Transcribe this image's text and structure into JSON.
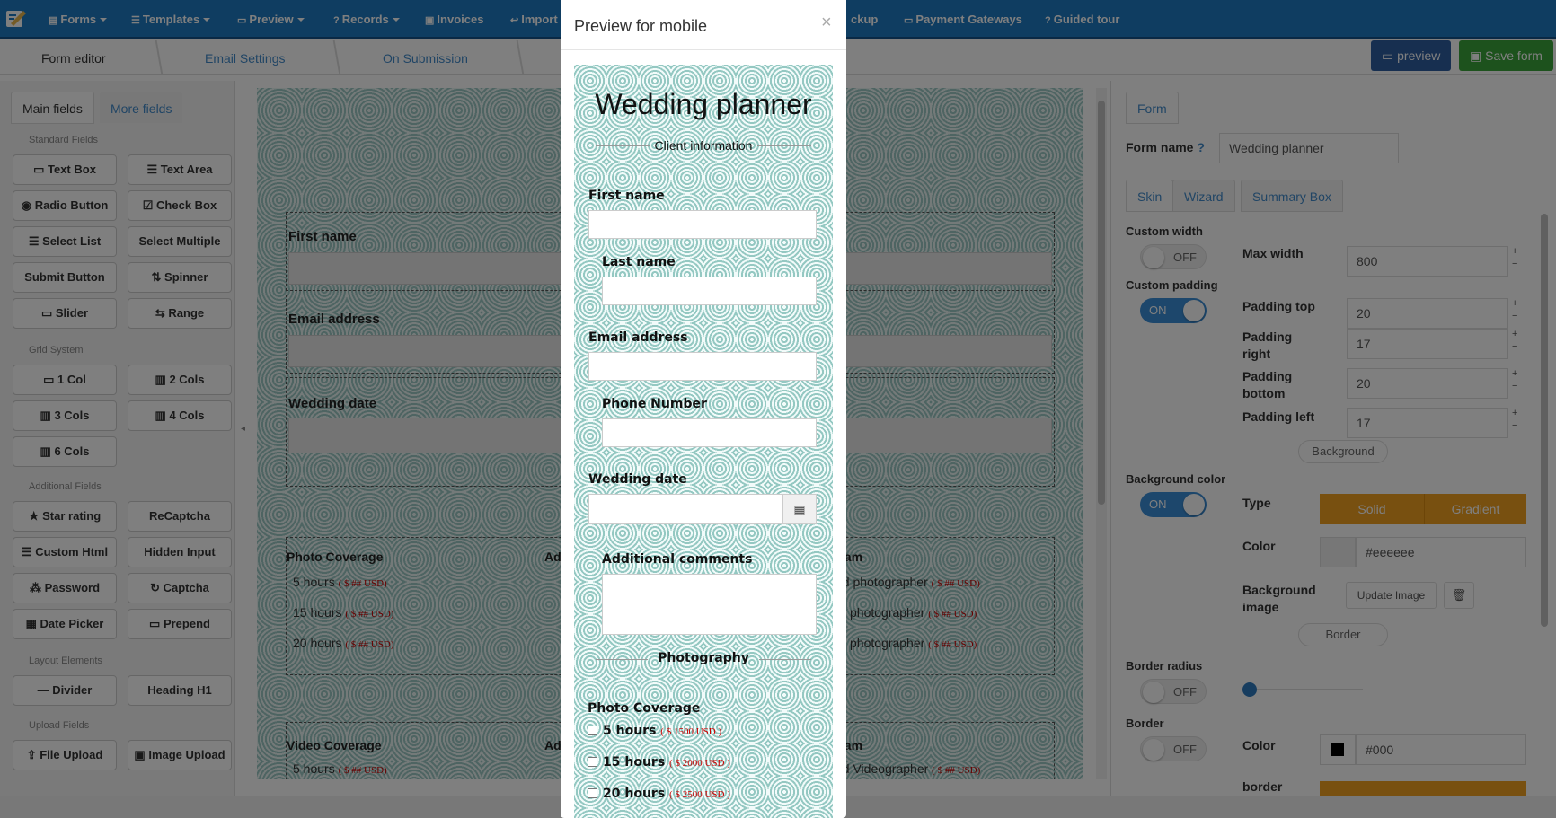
{
  "nav": {
    "items": [
      {
        "label": "Forms",
        "icon": "file-icon"
      },
      {
        "label": "Templates",
        "icon": "list-icon"
      },
      {
        "label": "Preview",
        "icon": "monitor-icon"
      },
      {
        "label": "Records",
        "icon": "question-icon"
      },
      {
        "label": "Invoices",
        "icon": "invoice-icon"
      },
      {
        "label": "Import",
        "icon": "reply-icon"
      },
      {
        "label": "ckup",
        "icon": ""
      },
      {
        "label": "Payment Gateways",
        "icon": "credit-card-icon"
      },
      {
        "label": "Guided tour",
        "icon": "question-icon"
      }
    ]
  },
  "editor_tabs": {
    "form_editor": "Form editor",
    "email_settings": "Email Settings",
    "on_submission": "On Submission"
  },
  "header_buttons": {
    "preview": "preview",
    "save": "Save form"
  },
  "left_panel": {
    "tabs": {
      "main": "Main fields",
      "more": "More fields"
    },
    "groups": {
      "standard": "Standard Fields",
      "grid": "Grid System",
      "additional": "Additional Fields",
      "layout": "Layout Elements",
      "upload": "Upload Fields"
    },
    "standard_fields": [
      "Text Box",
      "Text Area",
      "Radio Button",
      "Check Box",
      "Select List",
      "Select Multiple",
      "Submit Button",
      "Spinner",
      "Slider",
      "Range"
    ],
    "grid_fields": [
      "1 Col",
      "2 Cols",
      "3 Cols",
      "4 Cols",
      "6 Cols"
    ],
    "additional_fields": [
      "Star rating",
      "ReCaptcha",
      "Custom Html",
      "Hidden Input",
      "Password",
      "Captcha",
      "Date Picker",
      "Prepend"
    ],
    "layout_fields": [
      "Divider",
      "Heading H1"
    ],
    "upload_fields": [
      "File Upload",
      "Image Upload"
    ]
  },
  "canvas": {
    "labels": {
      "first_name": "First name",
      "email": "Email address",
      "wedding_date": "Wedding date",
      "photo_coverage": "Photo Coverage",
      "video_coverage": "Video Coverage",
      "col2_header": "Ad",
      "col3_header": "eam",
      "col3_header_video": "eam"
    },
    "photo_options": [
      "5 hours",
      "15 hours",
      "20 hours"
    ],
    "video_options": [
      "5 hours"
    ],
    "price_placeholder": "( $ ## USD)",
    "photo_team_options": [
      "nd photographer",
      "photographer",
      "photographer"
    ],
    "video_team_options": [
      "nd Videographer"
    ]
  },
  "right_panel": {
    "tab": "Form",
    "form_name_label": "Form name",
    "form_name_value": "Wedding planner",
    "subtabs": {
      "skin": "Skin",
      "wizard": "Wizard",
      "summary": "Summary Box"
    },
    "custom_width": {
      "label": "Custom width",
      "state": "OFF"
    },
    "max_width": {
      "label": "Max width",
      "value": "800"
    },
    "custom_padding": {
      "label": "Custom padding",
      "state": "ON"
    },
    "padding_top": {
      "label": "Padding top",
      "value": "20"
    },
    "padding_right": {
      "label1": "Padding",
      "label2": "right",
      "value": "17"
    },
    "padding_bottom": {
      "label1": "Padding",
      "label2": "bottom",
      "value": "20"
    },
    "padding_left": {
      "label": "Padding left",
      "value": "17"
    },
    "background_section": "Background",
    "bg_color": {
      "label": "Background color",
      "state": "ON"
    },
    "type": {
      "label": "Type",
      "solid": "Solid",
      "gradient": "Gradient"
    },
    "color": {
      "label": "Color",
      "value": "#eeeeee"
    },
    "bg_image": {
      "label1": "Background",
      "label2": "image",
      "button": "Update Image"
    },
    "border_section": "Border",
    "border_radius": {
      "label": "Border radius",
      "state": "OFF"
    },
    "border": {
      "label": "Border",
      "state": "OFF"
    },
    "border_color": {
      "label": "Color",
      "value": "#000"
    },
    "border_width_label": "border"
  },
  "modal": {
    "title": "Preview for mobile",
    "close": "×",
    "form_title": "Wedding planner",
    "section_client": "Client information",
    "first_name": "First name",
    "last_name": "Last name",
    "email": "Email address",
    "phone": "Phone Number",
    "wedding_date": "Wedding date",
    "comments": "Additional comments",
    "section_photo": "Photography",
    "photo_coverage": "Photo Coverage",
    "photo_options": [
      {
        "label": "5 hours",
        "price": "( $ 1500 USD )"
      },
      {
        "label": "15 hours",
        "price": "( $ 2000 USD )"
      },
      {
        "label": "20 hours",
        "price": "( $ 2500 USD )"
      }
    ]
  },
  "colors": {
    "nav": "#1f7bc3",
    "preview_btn": "#2f5fa0",
    "save_btn": "#3aa53a",
    "accent_orange": "#f0a020"
  }
}
